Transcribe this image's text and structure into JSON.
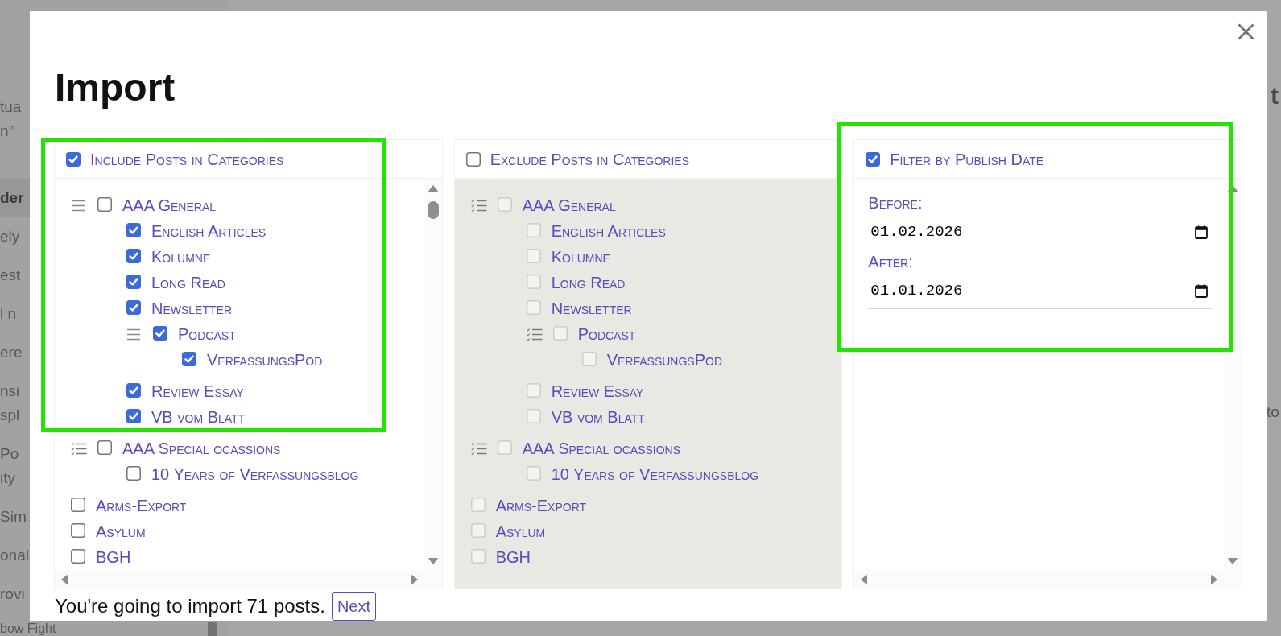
{
  "background_page": {
    "sidebar_items": [
      {
        "lines": [
          "tua",
          "n”"
        ],
        "selected": false
      },
      {
        "lines": [
          "der"
        ],
        "selected": true
      },
      {
        "lines": [
          "ely"
        ],
        "selected": false
      },
      {
        "lines": [
          "est"
        ],
        "selected": false
      },
      {
        "lines": [
          "l n"
        ],
        "selected": false
      },
      {
        "lines": [
          "ere"
        ],
        "selected": false
      },
      {
        "lines": [
          "nsi",
          "spl"
        ],
        "selected": false
      },
      {
        "lines": [
          "Po",
          "ity"
        ],
        "selected": false
      },
      {
        "lines": [
          "Sim"
        ],
        "selected": false
      },
      {
        "lines": [
          "onal"
        ],
        "selected": false
      },
      {
        "lines": [
          "rovi"
        ],
        "selected": false
      },
      {
        "lines": [
          "bow Fight"
        ],
        "selected": false
      }
    ],
    "right_edge_texts": [
      {
        "kind": "heading",
        "text": "t"
      },
      {
        "kind": "body",
        "text": "to"
      }
    ]
  },
  "dialog": {
    "title": "Import",
    "panels": [
      {
        "kind": "categories",
        "title": "Include Posts in Categories",
        "checked": true,
        "highlighted": true,
        "categories": [
          {
            "label": "AAA General",
            "checked": false,
            "children": [
              {
                "label": "English Articles",
                "checked": true
              },
              {
                "label": "Kolumne",
                "checked": true
              },
              {
                "label": "Long Read",
                "checked": true
              },
              {
                "label": "Newsletter",
                "checked": true
              },
              {
                "label": "Podcast",
                "checked": true,
                "children": [
                  {
                    "label": "VerfassungsPod",
                    "checked": true
                  }
                ]
              },
              {
                "label": "Review Essay",
                "checked": true
              },
              {
                "label": "VB vom Blatt",
                "checked": true
              }
            ]
          },
          {
            "label": "AAA Special ocassions",
            "checked": false,
            "children": [
              {
                "label": "10 Years of Verfassungsblog",
                "checked": false
              }
            ]
          },
          {
            "label": "Arms-Export",
            "checked": false
          },
          {
            "label": "Asylum",
            "checked": false
          },
          {
            "label": "BGH",
            "checked": false
          }
        ]
      },
      {
        "kind": "categories",
        "title": "Exclude Posts in Categories",
        "checked": false,
        "highlighted": false,
        "categories": [
          {
            "label": "AAA General",
            "checked": false,
            "children": [
              {
                "label": "English Articles",
                "checked": false
              },
              {
                "label": "Kolumne",
                "checked": false
              },
              {
                "label": "Long Read",
                "checked": false
              },
              {
                "label": "Newsletter",
                "checked": false
              },
              {
                "label": "Podcast",
                "checked": false,
                "children": [
                  {
                    "label": "VerfassungsPod",
                    "checked": false
                  }
                ]
              },
              {
                "label": "Review Essay",
                "checked": false
              },
              {
                "label": "VB vom Blatt",
                "checked": false
              }
            ]
          },
          {
            "label": "AAA Special ocassions",
            "checked": false,
            "children": [
              {
                "label": "10 Years of Verfassungsblog",
                "checked": false
              }
            ]
          },
          {
            "label": "Arms-Export",
            "checked": false
          },
          {
            "label": "Asylum",
            "checked": false
          },
          {
            "label": "BGH",
            "checked": false
          }
        ]
      },
      {
        "kind": "date_filter",
        "title": "Filter by Publish Date",
        "checked": true,
        "highlighted": true,
        "fields": [
          {
            "label": "Before:",
            "value": "01.02.2026"
          },
          {
            "label": "After:",
            "value": "01.01.2026"
          }
        ]
      }
    ],
    "summary": "You're going to import 71 posts.",
    "next_button": "Next"
  }
}
